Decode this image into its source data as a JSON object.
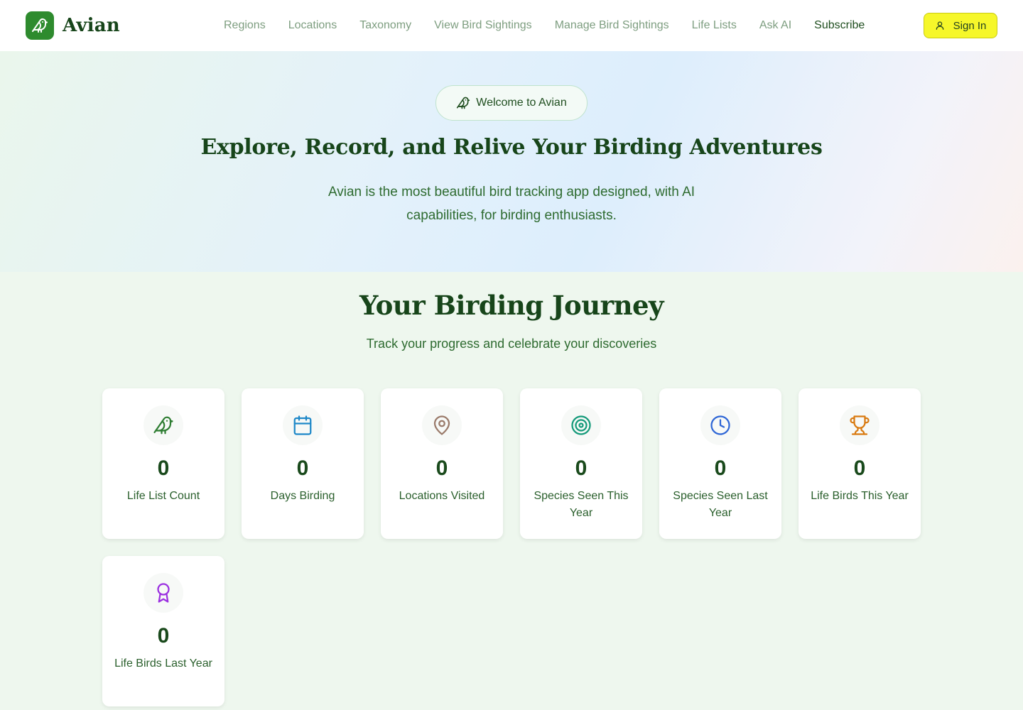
{
  "brand": {
    "name": "Avian",
    "logo_icon": "bird-icon",
    "accent": "#2e8b2e"
  },
  "nav": {
    "items": [
      "Regions",
      "Locations",
      "Taxonomy",
      "View Bird Sightings",
      "Manage Bird Sightings",
      "Life Lists",
      "Ask AI"
    ],
    "subscribe": "Subscribe",
    "sign_in": "Sign In"
  },
  "hero": {
    "badge": "Welcome to Avian",
    "title": "Explore, Record, and Relive Your Birding Adventures",
    "subtitle": "Avian is the most beautiful bird tracking app designed, with AI capabilities, for birding enthusiasts."
  },
  "journey": {
    "title": "Your Birding Journey",
    "subtitle": "Track your progress and celebrate your discoveries",
    "stats": [
      {
        "value": "0",
        "label": "Life List Count",
        "icon": "bird-icon",
        "color": "#2e7d32"
      },
      {
        "value": "0",
        "label": "Days Birding",
        "icon": "calendar-icon",
        "color": "#1e88c8"
      },
      {
        "value": "0",
        "label": "Locations Visited",
        "icon": "map-pin-icon",
        "color": "#9a7a6a"
      },
      {
        "value": "0",
        "label": "Species Seen This Year",
        "icon": "target-icon",
        "color": "#159a7a"
      },
      {
        "value": "0",
        "label": "Species Seen Last Year",
        "icon": "clock-icon",
        "color": "#2e66d6"
      },
      {
        "value": "0",
        "label": "Life Birds This Year",
        "icon": "trophy-icon",
        "color": "#d97a10"
      },
      {
        "value": "0",
        "label": "Life Birds Last Year",
        "icon": "award-icon",
        "color": "#9b30e0"
      }
    ]
  }
}
